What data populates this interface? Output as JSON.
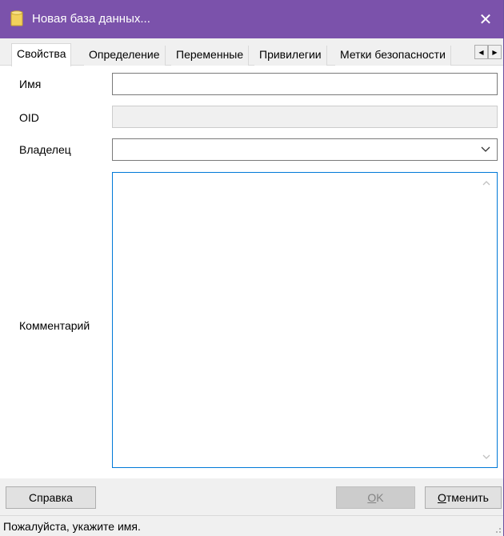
{
  "window": {
    "title": "Новая база данных...",
    "accent_color": "#7b52ab",
    "app_icon": "database-icon",
    "close_icon": "close-icon",
    "close_glyph": "✕"
  },
  "tabs": [
    {
      "label": "Свойства",
      "active": true
    },
    {
      "label": "Определение",
      "active": false
    },
    {
      "label": "Переменные",
      "active": false
    },
    {
      "label": "Привилегии",
      "active": false
    },
    {
      "label": "Метки безопасности",
      "active": false
    }
  ],
  "tab_scroll": {
    "left_glyph": "◀",
    "right_glyph": "▶"
  },
  "form": {
    "name": {
      "label": "Имя",
      "value": ""
    },
    "oid": {
      "label": "OID",
      "value": ""
    },
    "owner": {
      "label": "Владелец",
      "value": ""
    },
    "comment": {
      "label": "Комментарий",
      "value": ""
    }
  },
  "buttons": {
    "help": "Справка",
    "ok_accel": "O",
    "ok_rest": "K",
    "cancel_accel": "О",
    "cancel_rest": "тменить"
  },
  "status": {
    "text": "Пожалуйста, укажите имя."
  }
}
